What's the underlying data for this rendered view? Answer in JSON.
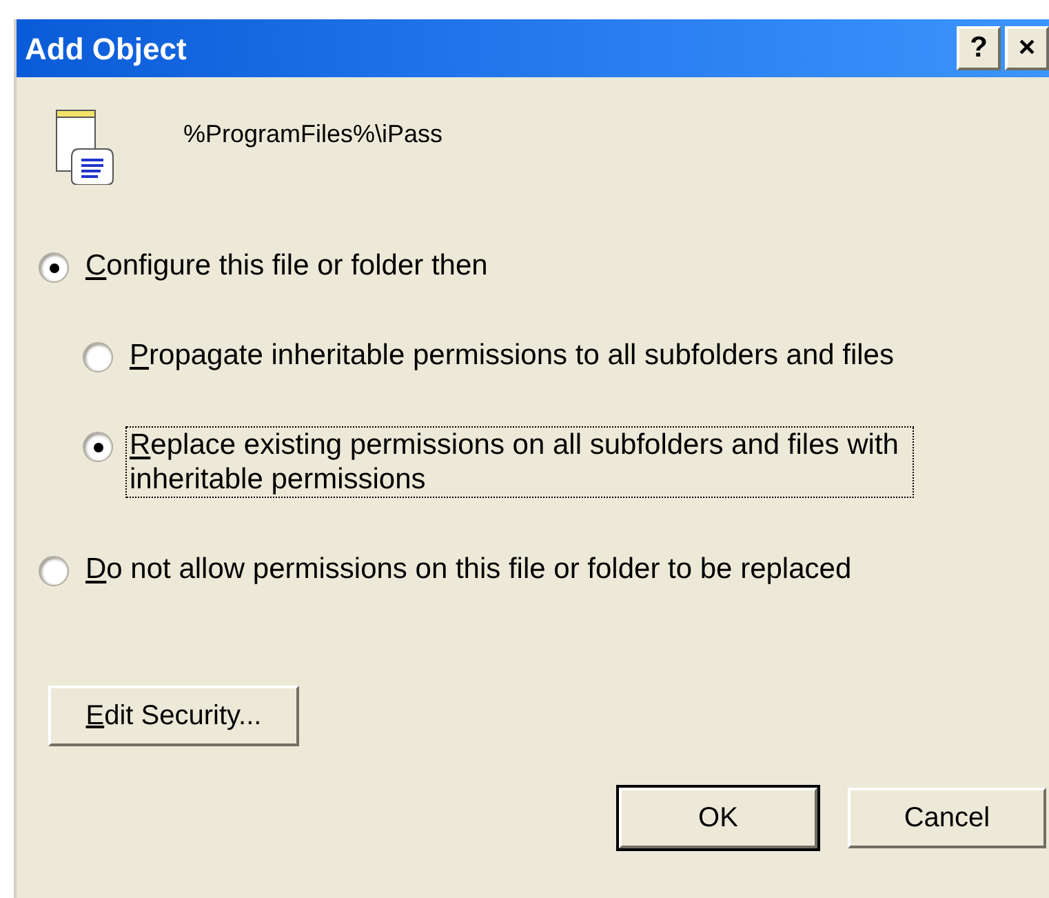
{
  "window": {
    "title": "Add Object",
    "title_buttons": [
      "?",
      "×"
    ]
  },
  "object_path": "%ProgramFiles%\\iPass",
  "options": [
    {
      "label": "Configure this file or folder then",
      "underline_first": true,
      "selected": true,
      "focused": false,
      "children": [
        {
          "label": "Propagate inheritable permissions to all subfolders and files",
          "underline_first": true,
          "selected": false,
          "focused": false
        },
        {
          "label": "Replace existing permissions on all subfolders and files with inheritable permissions",
          "underline_first": true,
          "selected": true,
          "focused": true
        }
      ]
    },
    {
      "label": "Do not allow permissions on this file or folder to be replaced",
      "underline_first": true,
      "selected": false,
      "focused": false
    }
  ],
  "buttons": [
    {
      "label": "Edit Security...",
      "underline_first": true,
      "default": false,
      "kind": "side"
    },
    {
      "label": "OK",
      "underline_first": false,
      "default": true,
      "kind": "footer"
    },
    {
      "label": "Cancel",
      "underline_first": false,
      "default": false,
      "kind": "footer"
    }
  ]
}
